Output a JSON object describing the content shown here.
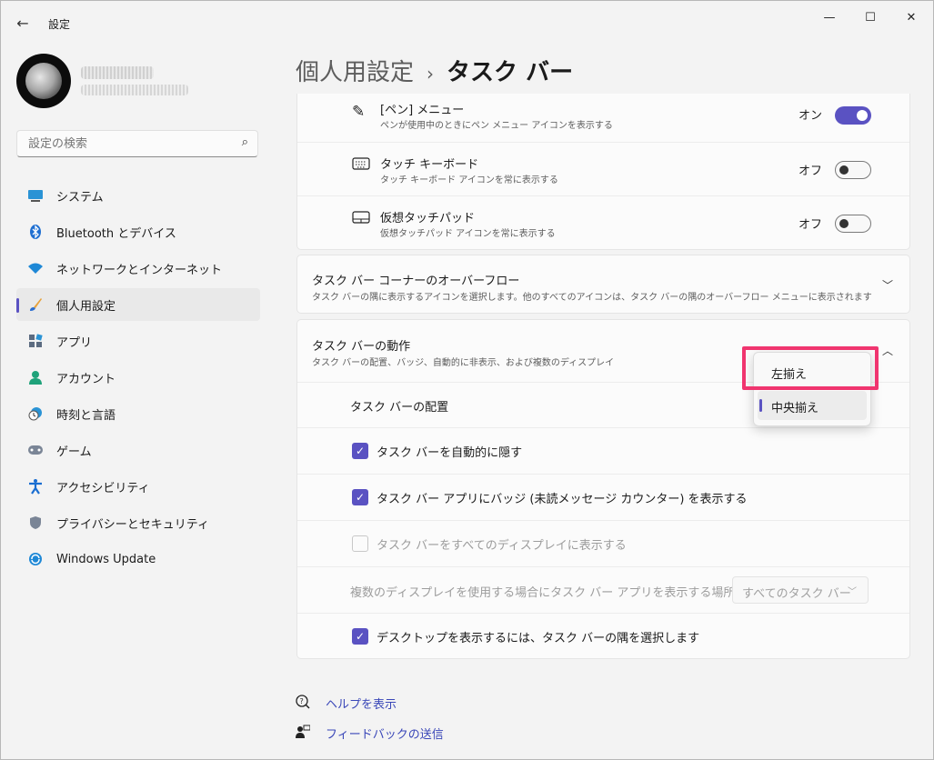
{
  "app": {
    "title": "設定"
  },
  "window_controls": {
    "minimize": "—",
    "maximize": "☐",
    "close": "✕"
  },
  "search": {
    "placeholder": "設定の検索"
  },
  "sidebar": {
    "items": [
      {
        "label": "システム",
        "icon": "monitor-icon",
        "active": false
      },
      {
        "label": "Bluetooth とデバイス",
        "icon": "bluetooth-icon",
        "active": false
      },
      {
        "label": "ネットワークとインターネット",
        "icon": "wifi-icon",
        "active": false
      },
      {
        "label": "個人用設定",
        "icon": "brush-icon",
        "active": true
      },
      {
        "label": "アプリ",
        "icon": "apps-icon",
        "active": false
      },
      {
        "label": "アカウント",
        "icon": "account-icon",
        "active": false
      },
      {
        "label": "時刻と言語",
        "icon": "clock-globe-icon",
        "active": false
      },
      {
        "label": "ゲーム",
        "icon": "gamepad-icon",
        "active": false
      },
      {
        "label": "アクセシビリティ",
        "icon": "accessibility-icon",
        "active": false
      },
      {
        "label": "プライバシーとセキュリティ",
        "icon": "shield-icon",
        "active": false
      },
      {
        "label": "Windows Update",
        "icon": "update-icon",
        "active": false
      }
    ]
  },
  "breadcrumb": {
    "parent": "個人用設定",
    "separator": "›",
    "current": "タスク バー"
  },
  "corner_icons": [
    {
      "title": "[ペン] メニュー",
      "desc": "ペンが使用中のときにペン メニュー アイコンを表示する",
      "state": "オン",
      "on": true
    },
    {
      "title": "タッチ キーボード",
      "desc": "タッチ キーボード アイコンを常に表示する",
      "state": "オフ",
      "on": false
    },
    {
      "title": "仮想タッチパッド",
      "desc": "仮想タッチパッド アイコンを常に表示する",
      "state": "オフ",
      "on": false
    }
  ],
  "overflow": {
    "title": "タスク バー コーナーのオーバーフロー",
    "desc": "タスク バーの隅に表示するアイコンを選択します。他のすべてのアイコンは、タスク バーの隅のオーバーフロー メニューに表示されます"
  },
  "behavior": {
    "title": "タスク バーの動作",
    "desc": "タスク バーの配置、バッジ、自動的に非表示、および複数のディスプレイ",
    "alignment_label": "タスク バーの配置",
    "options": [
      {
        "label": "自動的に隠す",
        "text": "タスク バーを自動的に隠す",
        "checked": true,
        "disabled": false
      },
      {
        "label": "バッジ",
        "text": "タスク バー アプリにバッジ (未読メッセージ カウンター) を表示する",
        "checked": true,
        "disabled": false
      },
      {
        "label": "すべて",
        "text": "タスク バーをすべてのディスプレイに表示する",
        "checked": false,
        "disabled": true
      }
    ],
    "multi_display_label": "複数のディスプレイを使用する場合にタスク バー アプリを表示する場所",
    "multi_display_value": "すべてのタスク バー",
    "desktop_corner": {
      "text": "デスクトップを表示するには、タスク バーの隅を選択します",
      "checked": true
    }
  },
  "alignment_popup": {
    "options": [
      "左揃え",
      "中央揃え"
    ],
    "selected": "中央揃え",
    "highlighted": "左揃え",
    "highlight_color": "#f0356f"
  },
  "footer": {
    "help": "ヘルプを表示",
    "feedback": "フィードバックの送信"
  },
  "colors": {
    "accent": "#5a52c2",
    "link": "#3a47b8"
  }
}
